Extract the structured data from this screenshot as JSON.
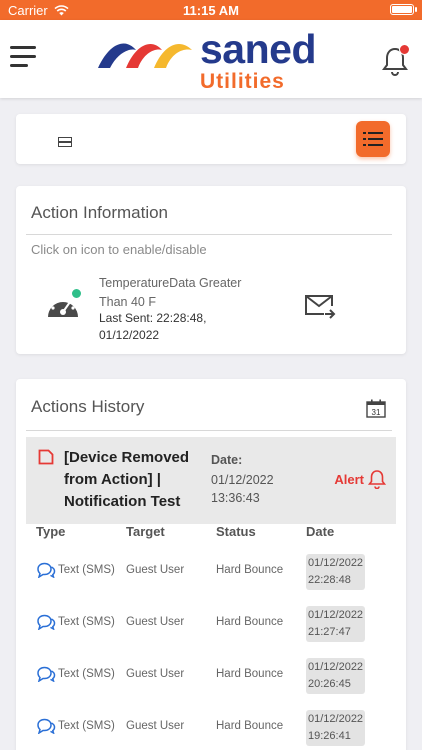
{
  "status_bar": {
    "carrier": "Carrier",
    "time": "11:15 AM"
  },
  "header": {
    "brand": "saned",
    "sub": "Utilities"
  },
  "colors": {
    "accent": "#f26b2b",
    "brand_blue": "#243a8c",
    "alert": "#e53935",
    "active": "#2fbf8a"
  },
  "icons": [
    "menu-icon",
    "bell-icon",
    "grid-view-icon",
    "list-view-icon",
    "gauge-icon",
    "mail-forward-icon",
    "calendar-icon",
    "document-icon",
    "chat-icon"
  ],
  "action_info": {
    "title": "Action Information",
    "hint": "Click on icon to enable/disable",
    "description": "TemperatureData Greater Than 40 F",
    "last_sent": "Last Sent: 22:28:48, 01/12/2022"
  },
  "history": {
    "title": "Actions History",
    "calendar_day": "31",
    "alert": {
      "name": "[Device Removed from Action] | Notification Test",
      "date_label": "Date:",
      "date_line1": "01/12/2022",
      "date_line2": "13:36:43",
      "badge": "Alert"
    },
    "columns": {
      "type": "Type",
      "target": "Target",
      "status": "Status",
      "date": "Date"
    },
    "rows": [
      {
        "type": "Text (SMS)",
        "target": "Guest User",
        "status": "Hard Bounce",
        "date1": "01/12/2022",
        "date2": "22:28:48"
      },
      {
        "type": "Text (SMS)",
        "target": "Guest User",
        "status": "Hard Bounce",
        "date1": "01/12/2022",
        "date2": "21:27:47"
      },
      {
        "type": "Text (SMS)",
        "target": "Guest User",
        "status": "Hard Bounce",
        "date1": "01/12/2022",
        "date2": "20:26:45"
      },
      {
        "type": "Text (SMS)",
        "target": "Guest User",
        "status": "Hard Bounce",
        "date1": "01/12/2022",
        "date2": "19:26:41"
      }
    ]
  }
}
